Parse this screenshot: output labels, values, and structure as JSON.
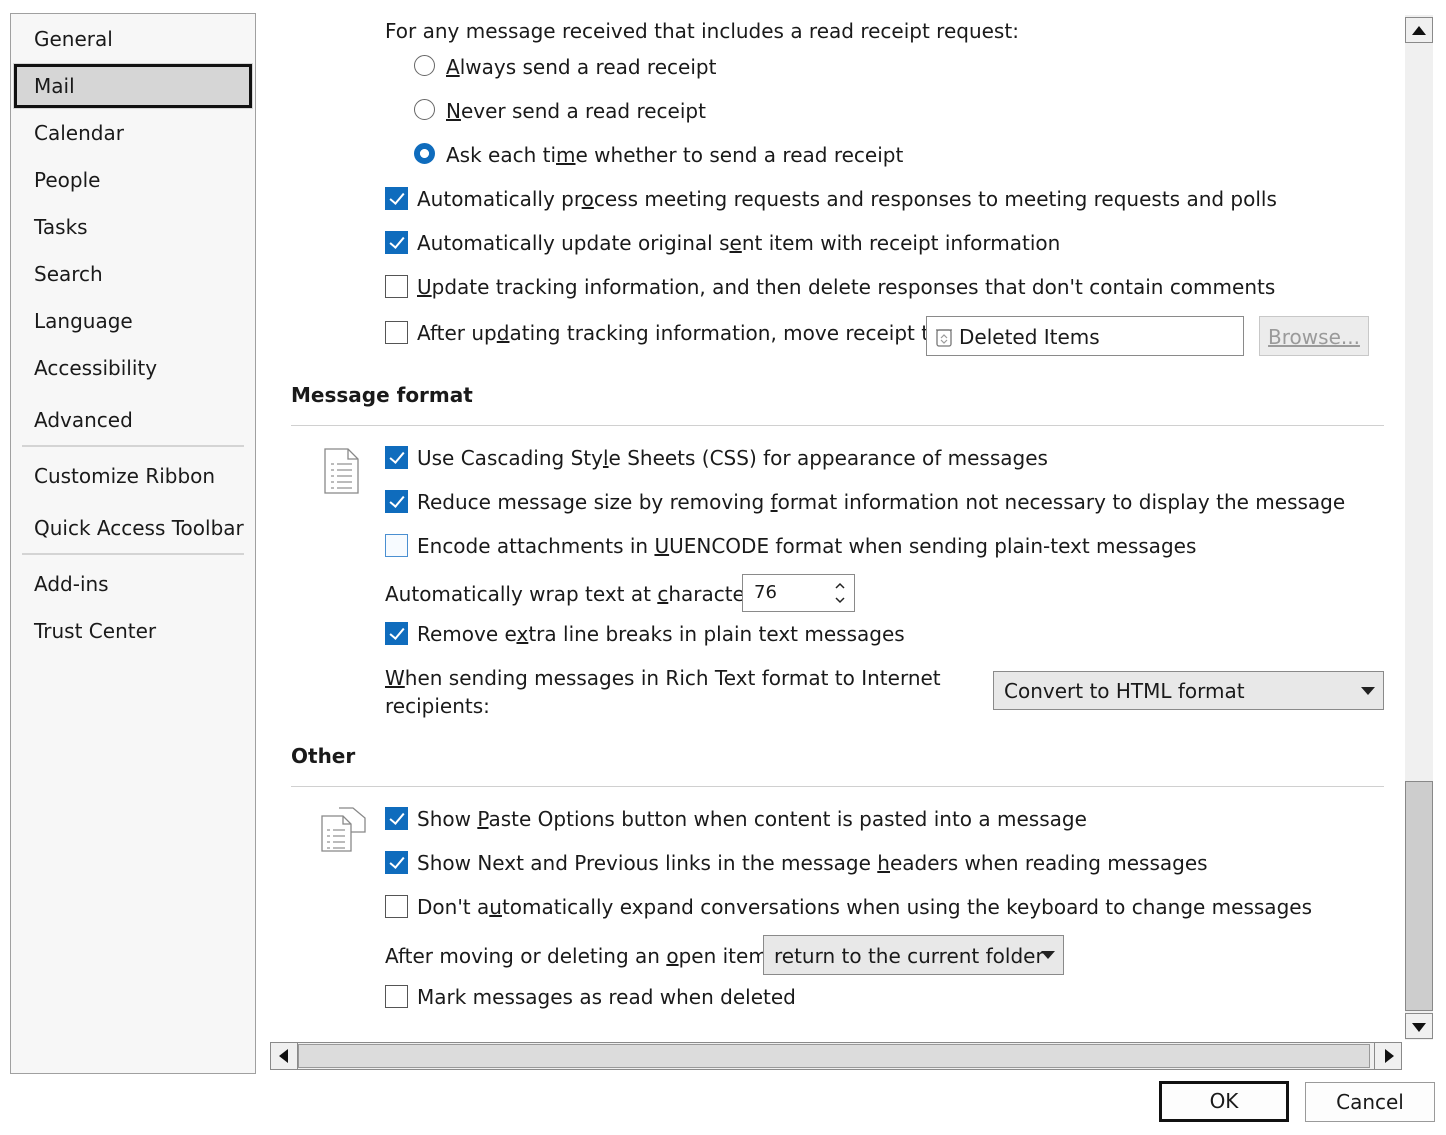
{
  "nav": {
    "items": [
      {
        "label": "General"
      },
      {
        "label": "Mail"
      },
      {
        "label": "Calendar"
      },
      {
        "label": "People"
      },
      {
        "label": "Tasks"
      },
      {
        "label": "Search"
      },
      {
        "label": "Language"
      },
      {
        "label": "Accessibility"
      },
      {
        "label": "Advanced"
      },
      {
        "label": "Customize Ribbon"
      },
      {
        "label": "Quick Access Toolbar"
      },
      {
        "label": "Add-ins"
      },
      {
        "label": "Trust Center"
      }
    ],
    "selected": "Mail"
  },
  "tracking": {
    "read_receipt_prompt": "For any message received that includes a read receipt request:",
    "radios": [
      {
        "label_pre": "",
        "mnemonic": "A",
        "label_post": "lways send a read receipt",
        "checked": false
      },
      {
        "label_pre": "",
        "mnemonic": "N",
        "label_post": "ever send a read receipt",
        "checked": false
      },
      {
        "label_pre": "Ask each ti",
        "mnemonic": "m",
        "label_post": "e whether to send a read receipt",
        "checked": true
      }
    ],
    "checkboxes": [
      {
        "label_pre": "Automatically pr",
        "mnemonic": "o",
        "label_post": "cess meeting requests and responses to meeting requests and polls",
        "checked": true
      },
      {
        "label_pre": "Automatically update original s",
        "mnemonic": "e",
        "label_post": "nt item with receipt information",
        "checked": true
      },
      {
        "label_pre": "",
        "mnemonic": "U",
        "label_post": "pdate tracking information, and then delete responses that don't contain comments",
        "checked": false
      },
      {
        "label_pre": "After up",
        "mnemonic": "d",
        "label_post": "ating tracking information, move receipt to:",
        "checked": false
      }
    ],
    "folder_value": "Deleted Items",
    "browse_label": "Browse..."
  },
  "message_format": {
    "title": "Message format",
    "checkboxes": [
      {
        "label_pre": "Use Cascading Sty",
        "mnemonic": "l",
        "label_post": "e Sheets (CSS) for appearance of messages",
        "checked": true
      },
      {
        "label_pre": "Reduce message size by removing ",
        "mnemonic": "f",
        "label_post": "ormat information not necessary to display the message",
        "checked": true
      },
      {
        "label_pre": "Encode attachments in ",
        "mnemonic": "U",
        "label_post": "UENCODE format when sending plain-text messages",
        "checked": false
      }
    ],
    "wrap_label_pre": "Automatically wrap text at ",
    "wrap_mnemonic": "c",
    "wrap_label_post": "haracter:",
    "wrap_value": "76",
    "remove_breaks": {
      "label_pre": "Remove e",
      "mnemonic": "x",
      "label_post": "tra line breaks in plain text messages",
      "checked": true
    },
    "rich_text_label_mnemonic": "W",
    "rich_text_label_line1": "hen sending messages in Rich Text format to Internet",
    "rich_text_label_line2": "recipients:",
    "rich_text_value": "Convert to HTML format"
  },
  "other": {
    "title": "Other",
    "checkboxes": [
      {
        "label_pre": "Show ",
        "mnemonic": "P",
        "label_post": "aste Options button when content is pasted into a message",
        "checked": true
      },
      {
        "label_pre": "Show Next and Previous links in the message ",
        "mnemonic": "h",
        "label_post": "eaders when reading messages",
        "checked": true
      },
      {
        "label_pre": "Don't a",
        "mnemonic": "u",
        "label_post": "tomatically expand conversations when using the keyboard to change messages",
        "checked": false
      }
    ],
    "after_move_label_pre": "After moving or deleting an ",
    "after_move_mnemonic": "o",
    "after_move_label_post": "pen item:",
    "after_move_value": "return to the current folder",
    "mark_read": {
      "label": "Mark messages as read when deleted",
      "checked": false
    }
  },
  "footer": {
    "ok_label": "OK",
    "cancel_label": "Cancel"
  }
}
